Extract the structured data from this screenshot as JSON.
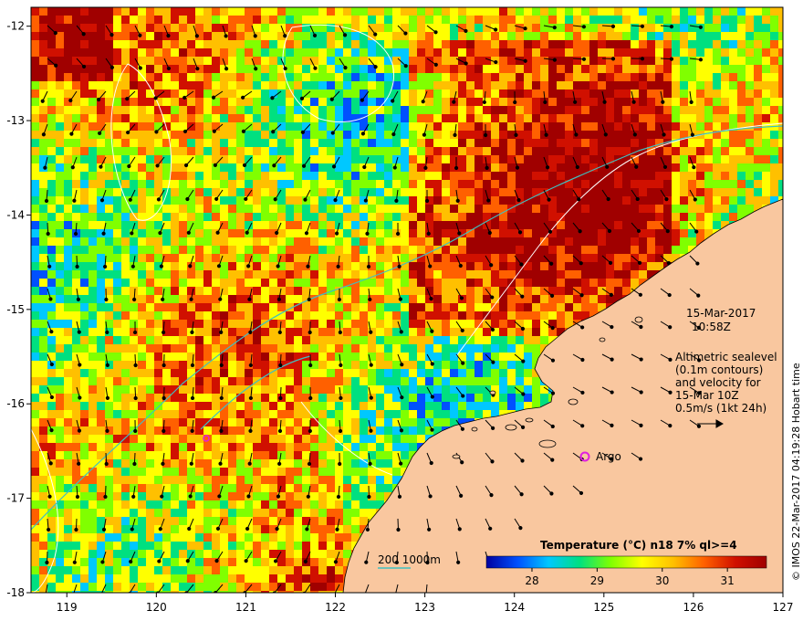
{
  "map": {
    "lon_ticks": [
      "119",
      "120",
      "121",
      "122",
      "123",
      "124",
      "125",
      "126",
      "127"
    ],
    "lat_ticks": [
      "-12",
      "-13",
      "-14",
      "-15",
      "-16",
      "-17",
      "-18"
    ],
    "lon_range": [
      118.6,
      127.0
    ],
    "lat_range": [
      -11.8,
      -18.0
    ],
    "land_color": "#f9c79f",
    "grid": false
  },
  "annotations": {
    "date": "15-Mar-2017",
    "time": "10:58Z",
    "info_lines": [
      "Altimetric sealevel",
      "(0.1m contours)",
      "and velocity for",
      "15-Mar 10Z",
      "0.5m/s (1kt 24h)"
    ],
    "argo_label": "Argo",
    "argo_color": "#e020e0",
    "depth_legend": "200  1000m",
    "depth_legend_color": "#40c0c0",
    "credit": "© IMOS 22-Mar-2017 04:19:28 Hobart time"
  },
  "colorbar": {
    "title": "Temperature (°C) n18 7% ql>=4",
    "ticks": [
      "28",
      "29",
      "30",
      "31"
    ],
    "range": [
      27.3,
      31.6
    ],
    "colors": [
      "#0000a0",
      "#0050ff",
      "#00c8ff",
      "#00e080",
      "#80ff00",
      "#ffff00",
      "#ffc000",
      "#ff6000",
      "#d01000",
      "#a00000"
    ]
  }
}
